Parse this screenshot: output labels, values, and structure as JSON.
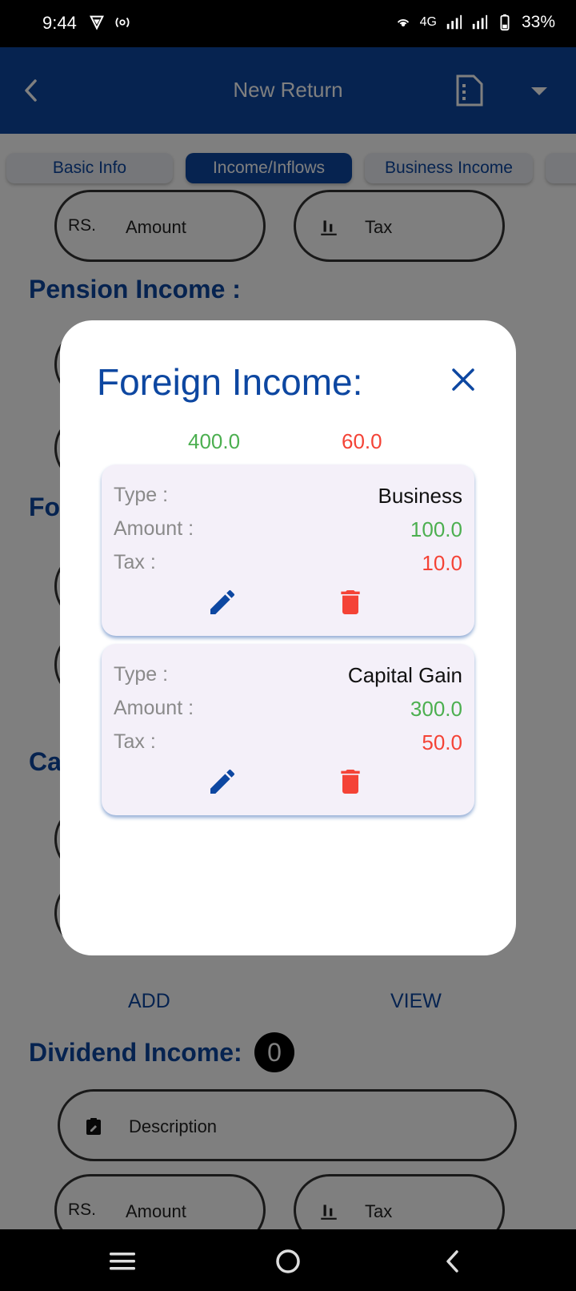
{
  "status_bar": {
    "time": "9:44",
    "network": "4G",
    "battery": "33%"
  },
  "app_bar": {
    "title": "New Return",
    "back_icon": "arrow-back-icon",
    "document_icon": "document-icon",
    "menu_icon": "dropdown-arrow-icon"
  },
  "tabs": [
    {
      "label": "Basic Info",
      "active": false
    },
    {
      "label": "Income/Inflows",
      "active": true
    },
    {
      "label": "Business Income",
      "active": false
    }
  ],
  "background_form": {
    "amount_prefix": "RS.",
    "amount_label": "Amount",
    "tax_label": "Tax",
    "pension_title": "Pension Income :",
    "foreign_title_partial": "Fo",
    "capital_title_partial": "Ca",
    "add_label": "ADD",
    "view_label": "VIEW",
    "dividend_title": "Dividend Income:",
    "dividend_count": "0",
    "description_label": "Description"
  },
  "dialog": {
    "title": "Foreign Income:",
    "total_amount": "400.0",
    "total_tax": "60.0",
    "labels": {
      "type": "Type :",
      "amount": "Amount :",
      "tax": "Tax :"
    },
    "entries": [
      {
        "type": "Business",
        "amount": "100.0",
        "tax": "10.0"
      },
      {
        "type": "Capital Gain",
        "amount": "300.0",
        "tax": "50.0"
      }
    ]
  },
  "colors": {
    "primary": "#0d47a1",
    "positive": "#4caf50",
    "negative": "#f44336",
    "card_bg": "#f4f0f9"
  }
}
